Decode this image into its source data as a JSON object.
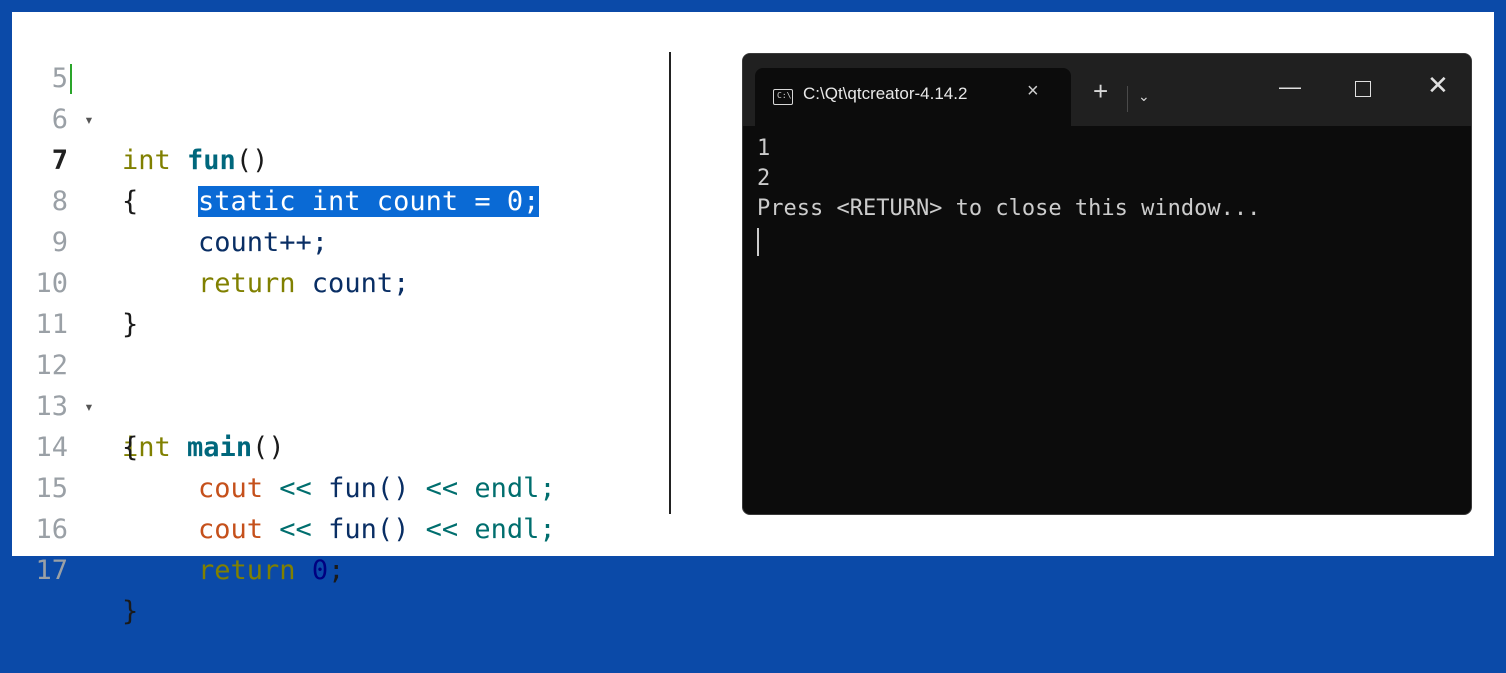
{
  "editor": {
    "lines": [
      {
        "n": "5"
      },
      {
        "n": "6"
      },
      {
        "n": "7"
      },
      {
        "n": "8"
      },
      {
        "n": "9"
      },
      {
        "n": "10"
      },
      {
        "n": "11"
      },
      {
        "n": "12"
      },
      {
        "n": "13"
      },
      {
        "n": "14"
      },
      {
        "n": "15"
      },
      {
        "n": "16"
      },
      {
        "n": "17"
      }
    ],
    "tokens": {
      "int": "int",
      "fun": "fun",
      "parens": "()",
      "open_brace": "{",
      "close_brace": "}",
      "static_line": "static int count = 0;",
      "count_inc": "count++;",
      "return_kw": "return",
      "count_ret": " count;",
      "main": "main",
      "cout": "cout",
      "shl": "<<",
      "fun_call": "fun()",
      "endl": "endl;",
      "zero": "0",
      "semi": ";"
    },
    "current_line": "7",
    "selected_text": "static int count = 0;"
  },
  "terminal": {
    "tab_title": "C:\\Qt\\qtcreator-4.14.2",
    "tab_icon_text": "C:\\",
    "close_tab": "×",
    "new_tab": "+",
    "dropdown": "⌄",
    "minimize": "—",
    "close_window": "✕",
    "output": [
      "1",
      "2",
      "Press <RETURN> to close this window..."
    ]
  },
  "colors": {
    "background_border": "#0b4aa8",
    "selection": "#0a6ad5",
    "terminal_bg": "#0c0c0c"
  }
}
